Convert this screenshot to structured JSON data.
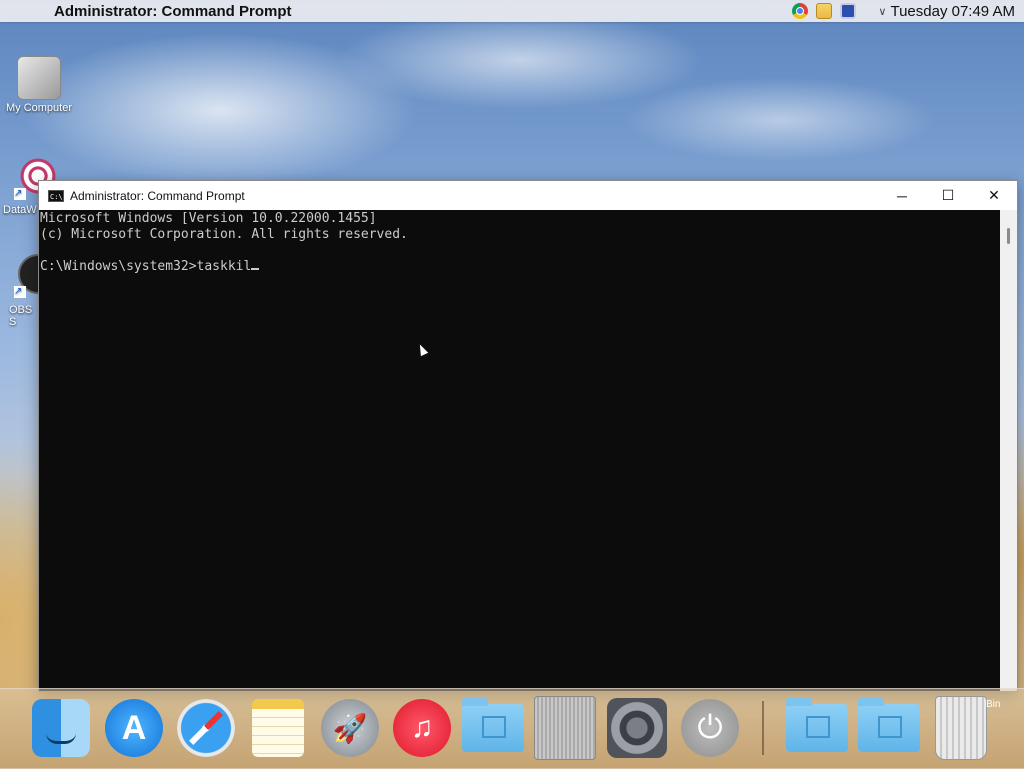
{
  "menubar": {
    "app_title": "Administrator:  Command Prompt",
    "clock": "Tuesday 07:49 AM"
  },
  "desktop_icons": [
    {
      "label": "My Computer",
      "icon": "computer-icon"
    },
    {
      "label": "DataW",
      "icon": "datawatch-icon"
    },
    {
      "label": "OBS S",
      "icon": "obs-icon"
    }
  ],
  "cmd_window": {
    "title": "Administrator:  Command Prompt",
    "lines": [
      "Microsoft Windows [Version 10.0.22000.1455]",
      "(c) Microsoft Corporation. All rights reserved.",
      "",
      "C:\\Windows\\system32>taskkil"
    ],
    "controls": {
      "minimize": "─",
      "maximize": "☐",
      "close": "✕"
    }
  },
  "dock": {
    "items": [
      "finder-icon",
      "app-store-icon",
      "safari-icon",
      "notes-icon",
      "launchpad-icon",
      "music-icon",
      "applications-folder-icon",
      "mac-pro-icon",
      "system-preferences-icon",
      "power-icon",
      "documents-folder-icon",
      "downloads-folder-icon",
      "trash-icon"
    ],
    "trash_label": "Bin"
  }
}
